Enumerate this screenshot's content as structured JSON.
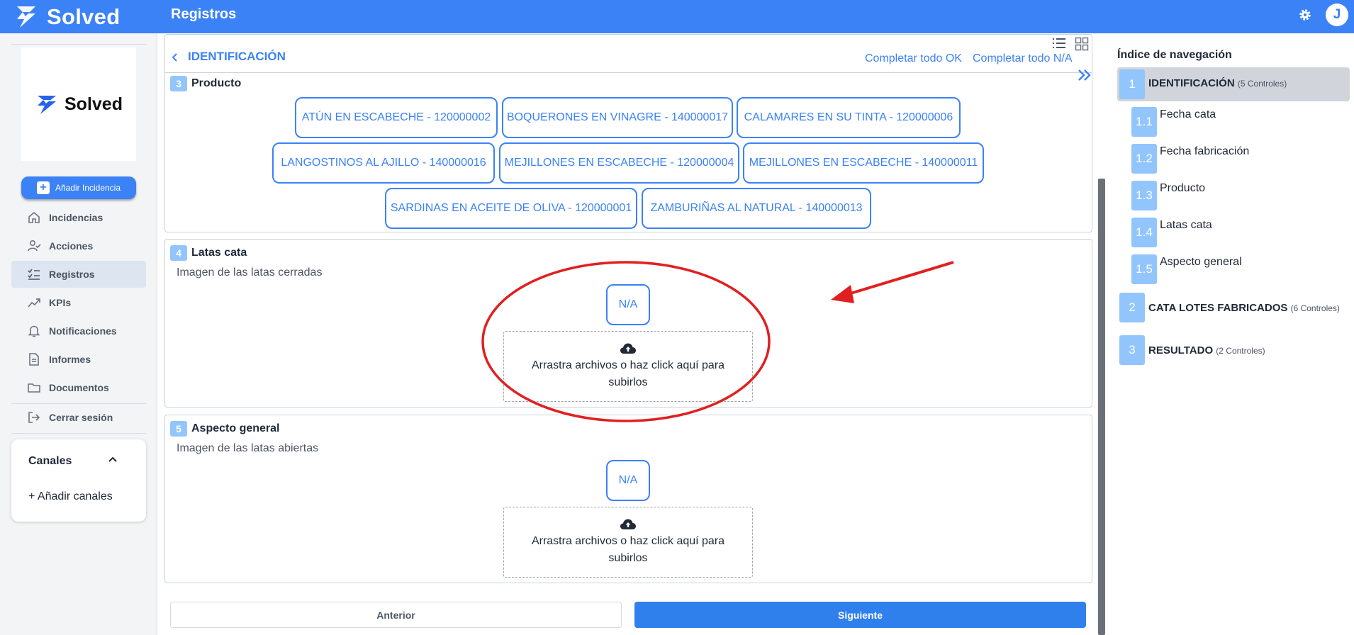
{
  "app": {
    "brand": "Solved",
    "page_title": "Registros",
    "user_initial": "J"
  },
  "sidebar": {
    "logo_text": "Solved",
    "add_button": "Añadir Incidencia",
    "items": [
      {
        "label": "Incidencias",
        "icon": "home-icon"
      },
      {
        "label": "Acciones",
        "icon": "user-check-icon"
      },
      {
        "label": "Registros",
        "icon": "checklist-icon",
        "active": true
      },
      {
        "label": "KPIs",
        "icon": "trend-icon"
      },
      {
        "label": "Notificaciones",
        "icon": "bell-icon"
      },
      {
        "label": "Informes",
        "icon": "document-icon"
      },
      {
        "label": "Documentos",
        "icon": "folder-icon"
      },
      {
        "label": "Cerrar sesión",
        "icon": "logout-icon"
      }
    ],
    "channels": {
      "title": "Canales",
      "add": "+ Añadir canales"
    }
  },
  "main": {
    "section_title": "IDENTIFICACIÓN",
    "complete_ok": "Completar todo OK",
    "complete_na": "Completar todo N/A",
    "sections": [
      {
        "number": "3",
        "title": "Producto",
        "options": [
          "ATÚN EN ESCABECHE - 120000002",
          "BOQUERONES EN VINAGRE - 140000017",
          "CALAMARES EN SU TINTA - 120000006",
          "LANGOSTINOS AL AJILLO - 140000016",
          "MEJILLONES EN ESCABECHE - 120000004",
          "MEJILLONES EN ESCABECHE - 140000011",
          "SARDINAS EN ACEITE DE OLIVA - 120000001",
          "ZAMBURIÑAS AL NATURAL - 140000013"
        ]
      },
      {
        "number": "4",
        "title": "Latas cata",
        "subtitle": "Imagen de las latas cerradas",
        "na": "N/A",
        "upload": "Arrastra archivos o haz click aquí para subirlos"
      },
      {
        "number": "5",
        "title": "Aspecto general",
        "subtitle": "Imagen de las latas abiertas",
        "na": "N/A",
        "upload": "Arrastra archivos o haz click aquí para subirlos"
      }
    ],
    "prev": "Anterior",
    "next": "Siguiente"
  },
  "nav_index": {
    "title": "Índice de navegación",
    "groups": [
      {
        "number": "1",
        "title": "IDENTIFICACIÓN",
        "controls": "(5 Controles)",
        "children": [
          {
            "number": "1.1",
            "label": "Fecha cata"
          },
          {
            "number": "1.2",
            "label": "Fecha fabricación"
          },
          {
            "number": "1.3",
            "label": "Producto"
          },
          {
            "number": "1.4",
            "label": "Latas cata"
          },
          {
            "number": "1.5",
            "label": "Aspecto general"
          }
        ]
      },
      {
        "number": "2",
        "title": "CATA LOTES FABRICADOS",
        "controls": "(6 Controles)"
      },
      {
        "number": "3",
        "title": "RESULTADO",
        "controls": "(2 Controles)"
      }
    ]
  },
  "colors": {
    "primary": "#3b82f6",
    "badge": "#93c5fd",
    "annotation": "#e02020"
  }
}
